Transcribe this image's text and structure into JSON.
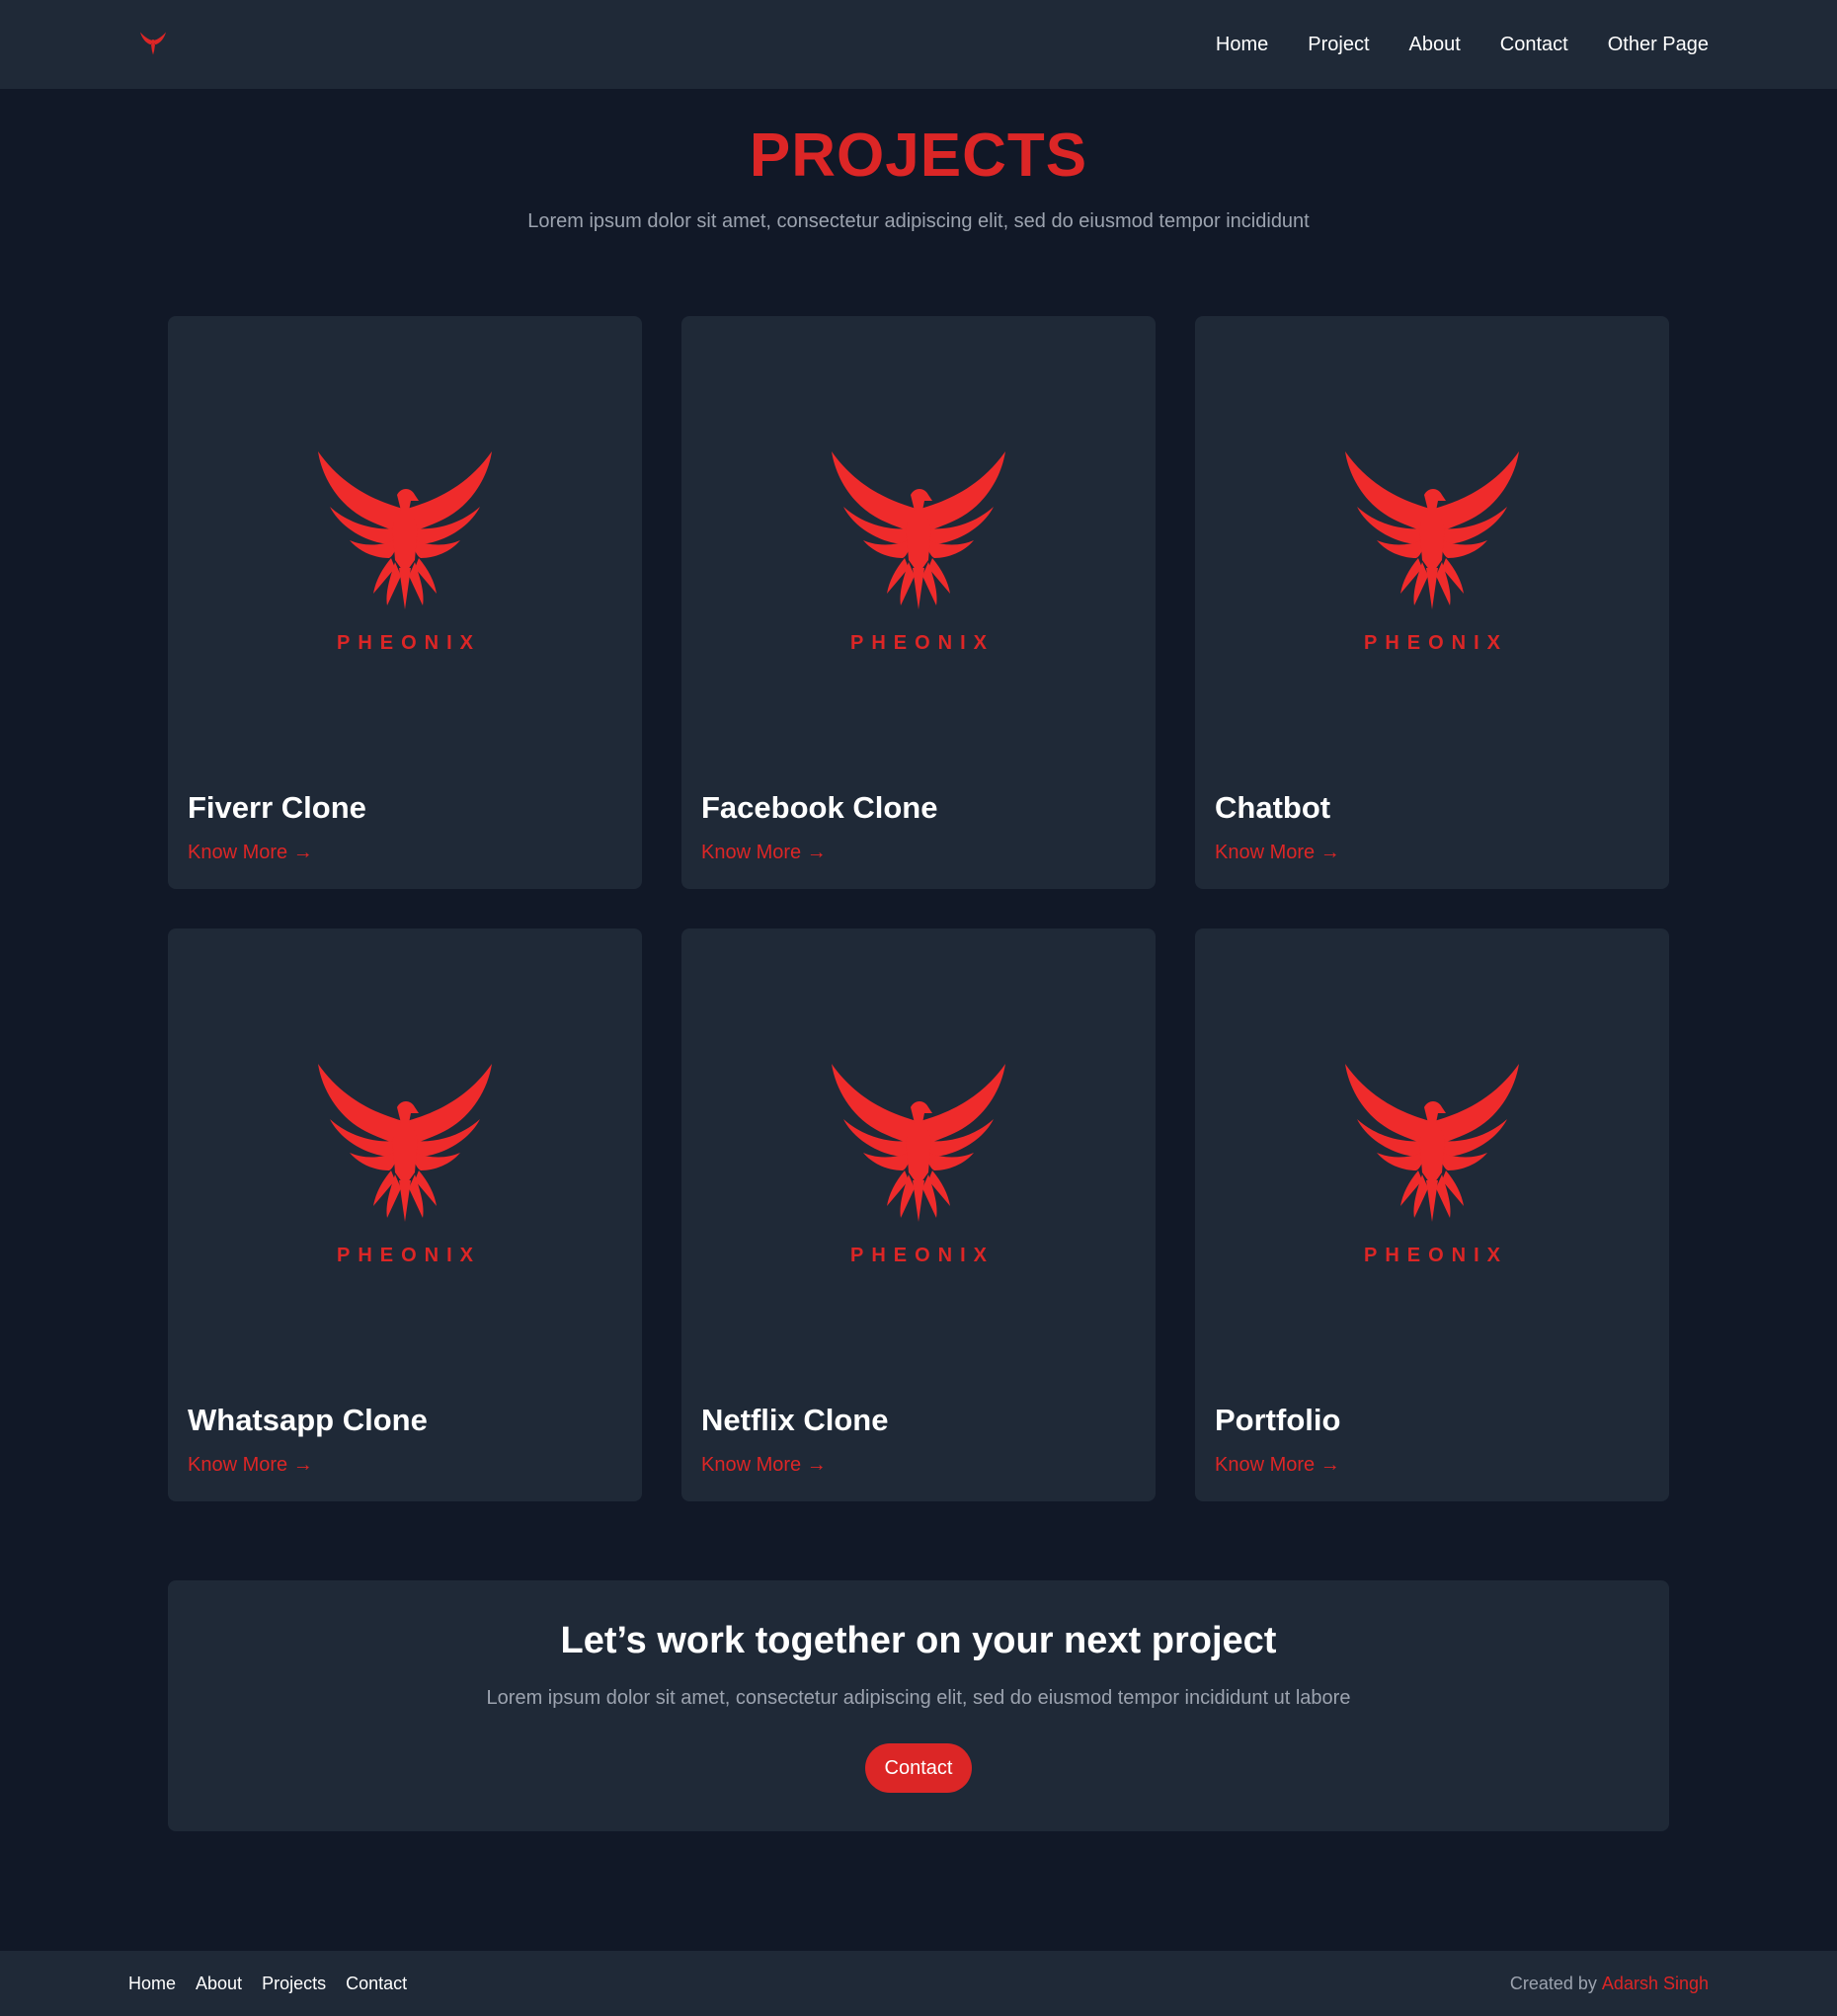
{
  "nav": {
    "logo_icon": "phoenix-logo-icon",
    "links": [
      "Home",
      "Project",
      "About",
      "Contact",
      "Other Page"
    ]
  },
  "hero": {
    "title": "PROJECTS",
    "subtitle": "Lorem ipsum dolor sit amet, consectetur adipiscing elit, sed do eiusmod tempor incididunt"
  },
  "projects": [
    {
      "title": "Fiverr Clone",
      "link": "Know More →",
      "brand": "PHEONIX"
    },
    {
      "title": "Facebook Clone",
      "link": "Know More →",
      "brand": "PHEONIX"
    },
    {
      "title": "Chatbot",
      "link": "Know More →",
      "brand": "PHEONIX"
    },
    {
      "title": "Whatsapp Clone",
      "link": "Know More →",
      "brand": "PHEONIX"
    },
    {
      "title": "Netflix Clone",
      "link": "Know More →",
      "brand": "PHEONIX"
    },
    {
      "title": "Portfolio",
      "link": "Know More →",
      "brand": "PHEONIX"
    }
  ],
  "cta": {
    "title": "Let’s work together on your next project",
    "subtitle": "Lorem ipsum dolor sit amet, consectetur adipiscing elit, sed do eiusmod tempor incididunt ut labore",
    "button": "Contact"
  },
  "footer": {
    "links": [
      "Home",
      "About",
      "Projects",
      "Contact"
    ],
    "credit_prefix": "Created by",
    "credit_name": "Adarsh Singh"
  },
  "colors": {
    "accent": "#dc2626",
    "background": "#111827",
    "surface": "#1f2937",
    "muted_text": "#9ca3af"
  }
}
